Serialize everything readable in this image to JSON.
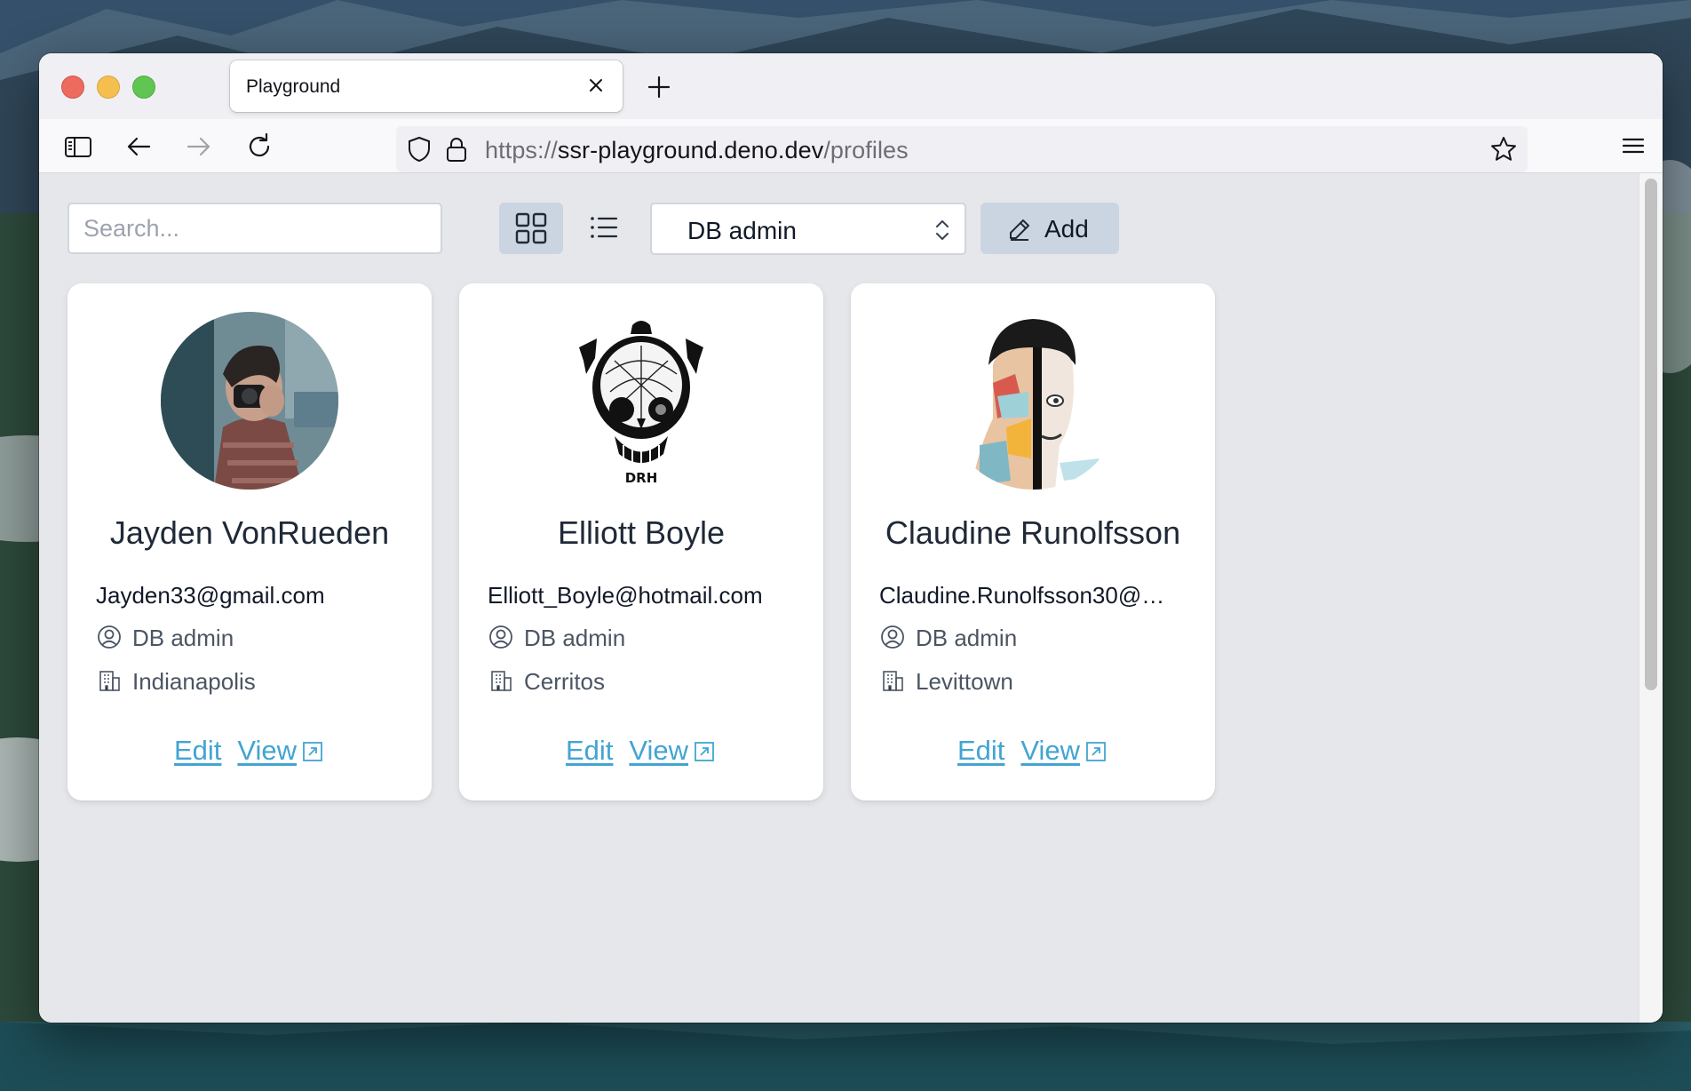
{
  "browser": {
    "tab_title": "Playground",
    "url_prefix": "https://",
    "url_host": "ssr-playground.deno.dev",
    "url_path": "/profiles"
  },
  "toolbar": {
    "search_placeholder": "Search...",
    "role_filter_value": "DB admin",
    "add_label": "Add"
  },
  "profiles": [
    {
      "name": "Jayden VonRueden",
      "email": "Jayden33@gmail.com",
      "role": "DB admin",
      "city": "Indianapolis",
      "edit_label": "Edit",
      "view_label": "View"
    },
    {
      "name": "Elliott Boyle",
      "email": "Elliott_Boyle@hotmail.com",
      "role": "DB admin",
      "city": "Cerritos",
      "edit_label": "Edit",
      "view_label": "View",
      "avatar_caption": "DRH"
    },
    {
      "name": "Claudine Runolfsson",
      "email": "Claudine.Runolfsson30@…",
      "role": "DB admin",
      "city": "Levittown",
      "edit_label": "Edit",
      "view_label": "View"
    }
  ],
  "colors": {
    "link": "#43a4d2",
    "content_bg": "#e5e7eb",
    "active_button": "#cbd5e1"
  }
}
